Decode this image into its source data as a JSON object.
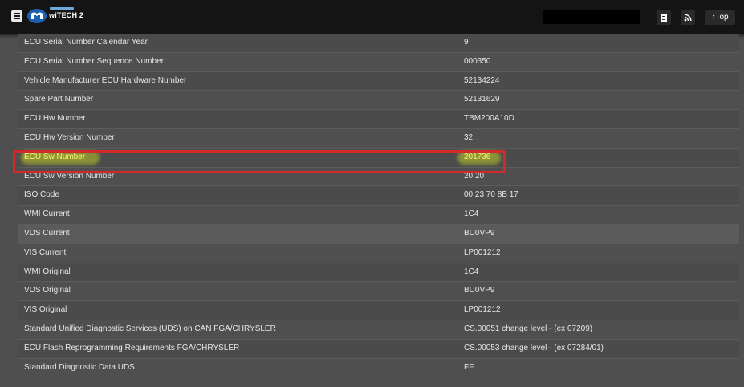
{
  "header": {
    "brand": "wiTECH 2",
    "actions": [
      {
        "icon": "document-icon"
      },
      {
        "icon": "rss-icon"
      },
      {
        "icon": "arrow-up-icon",
        "label": "Top"
      }
    ]
  },
  "colors": {
    "topbar": "#141414",
    "table_bg": "#4b4b4b",
    "text": "#e6e6e6",
    "highlight_text": "#f2f27a",
    "highlight_box": "#d02a2a"
  },
  "rows": [
    {
      "label": "ECU Serial Number Calendar Year",
      "value": "9"
    },
    {
      "label": "ECU Serial Number Sequence Number",
      "value": "000350"
    },
    {
      "label": "Vehicle Manufacturer ECU Hardware Number",
      "value": "52134224"
    },
    {
      "label": "Spare Part Number",
      "value": "52131629"
    },
    {
      "label": "ECU Hw Number",
      "value": "TBM200A10D"
    },
    {
      "label": "ECU Hw Version Number",
      "value": "32"
    },
    {
      "label": "ECU Sw Number",
      "value": "201736",
      "highlighted": true
    },
    {
      "label": "ECU Sw Version Number",
      "value": "20 20"
    },
    {
      "label": "ISO Code",
      "value": "00 23 70 8B 17"
    },
    {
      "label": "WMI Current",
      "value": "1C4"
    },
    {
      "label": "VDS Current",
      "value": "BU0VP9"
    },
    {
      "label": "VIS Current",
      "value": "LP001212"
    },
    {
      "label": "WMI Original",
      "value": "1C4"
    },
    {
      "label": "VDS Original",
      "value": "BU0VP9"
    },
    {
      "label": "VIS Original",
      "value": "LP001212"
    },
    {
      "label": "Standard Unified Diagnostic Services (UDS) on CAN FGA/CHRYSLER",
      "value": "CS.00051 change level - (ex 07209)"
    },
    {
      "label": "ECU Flash Reprogramming Requirements FGA/CHRYSLER",
      "value": "CS.00053 change level - (ex 07284/01)"
    },
    {
      "label": "Standard Diagnostic Data UDS",
      "value": "FF"
    }
  ]
}
